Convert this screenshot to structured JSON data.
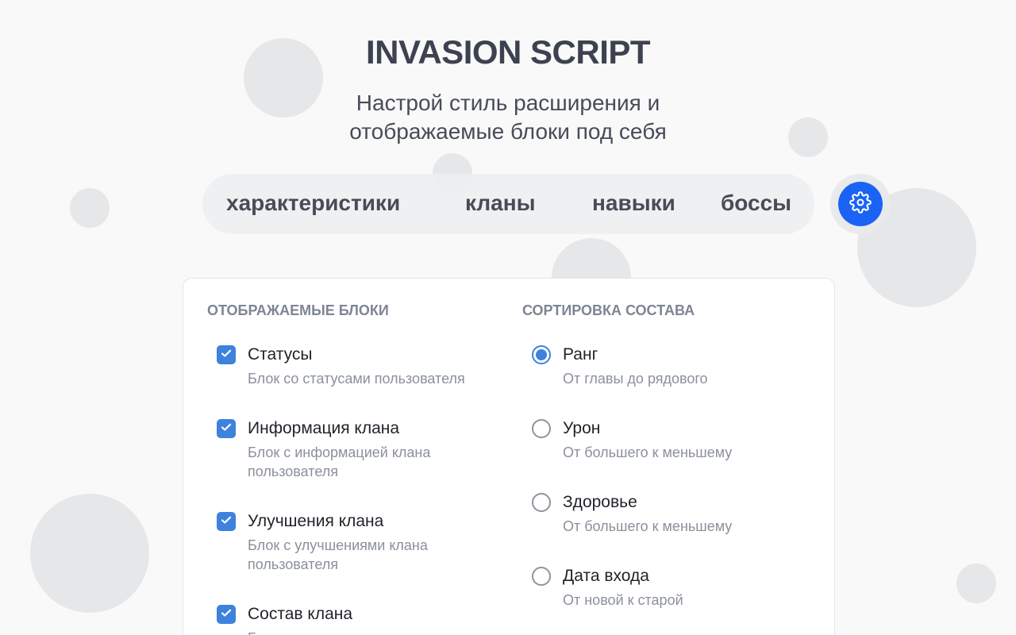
{
  "header": {
    "title": "INVASION SCRIPT",
    "subtitle_line1": "Настрой стиль расширения и",
    "subtitle_line2": "отображаемые блоки под себя"
  },
  "tabs": [
    {
      "label": "характеристики"
    },
    {
      "label": "кланы"
    },
    {
      "label": "навыки"
    },
    {
      "label": "боссы"
    }
  ],
  "settings_button": {
    "icon": "gear-icon",
    "color": "#1a63f5"
  },
  "panel": {
    "blocks": {
      "heading": "ОТОБРАЖАЕМЫЕ БЛОКИ",
      "items": [
        {
          "label": "Статусы",
          "desc": "Блок со статусами пользователя",
          "checked": true
        },
        {
          "label": "Информация клана",
          "desc": "Блок с информацией клана пользователя",
          "checked": true
        },
        {
          "label": "Улучшения клана",
          "desc": "Блок с улучшениями клана пользователя",
          "checked": true
        },
        {
          "label": "Состав клана",
          "desc": "Блок с составом клана",
          "checked": true
        }
      ]
    },
    "sorting": {
      "heading": "СОРТИРОВКА СОСТАВА",
      "items": [
        {
          "label": "Ранг",
          "desc": "От главы до рядового",
          "selected": true
        },
        {
          "label": "Урон",
          "desc": "От большего к меньшему",
          "selected": false
        },
        {
          "label": "Здоровье",
          "desc": "От большего к меньшему",
          "selected": false
        },
        {
          "label": "Дата входа",
          "desc": "От новой к старой",
          "selected": false
        }
      ]
    }
  },
  "colors": {
    "accent": "#3d82dd",
    "settings_blue": "#1a63f5",
    "background": "#f9f9f9",
    "bubble": "#e6e7e9"
  }
}
